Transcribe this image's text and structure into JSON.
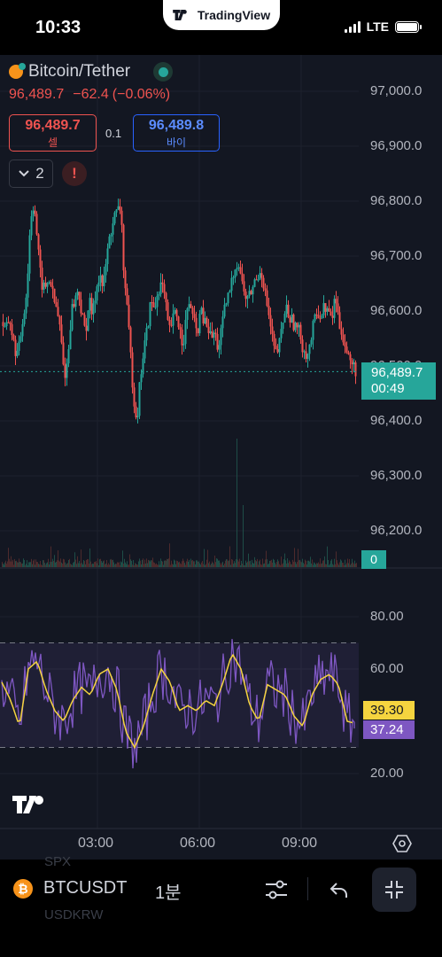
{
  "status_bar": {
    "time": "10:33",
    "network": "LTE",
    "app_brand": "TradingView"
  },
  "symbol": {
    "name": "Bitcoin/Tether",
    "last_price": "96,489.7",
    "change": "−62.4",
    "change_pct": "(−0.06%)"
  },
  "order": {
    "sell_price": "96,489.7",
    "sell_label": "셀",
    "spread": "0.1",
    "buy_price": "96,489.8",
    "buy_label": "바이"
  },
  "indicators_collapse": {
    "count": "2"
  },
  "price_axis": [
    "97,000.0",
    "96,900.0",
    "96,800.0",
    "96,700.0",
    "96,600.0",
    "96,500.0",
    "96,400.0",
    "96,300.0",
    "96,200.0"
  ],
  "price_tag": {
    "price": "96,489.7",
    "countdown": "00:49"
  },
  "volume_tag": "0",
  "rsi_axis": [
    "80.00",
    "60.00",
    "20.00"
  ],
  "rsi_tags": {
    "ma": "39.30",
    "rsi": "37.24"
  },
  "time_axis": [
    "03:00",
    "06:00",
    "09:00"
  ],
  "toolbar": {
    "ticker": "BTCUSDT",
    "interval": "1분",
    "ghost_above": "SPX",
    "ghost_below": "USDKRW"
  },
  "colors": {
    "up": "#26a69a",
    "down": "#ef5350",
    "rsi": "#7e57c2",
    "rsi_ma": "#f5d43f",
    "background": "#131722"
  },
  "chart_data": {
    "type": "candlestick",
    "price_ylim": [
      96150,
      97050
    ],
    "rsi_ylim": [
      20,
      80
    ],
    "rsi_band": [
      30,
      70
    ],
    "x_ticks": [
      "03:00",
      "06:00",
      "09:00"
    ],
    "close_path": [
      [
        0,
        96580
      ],
      [
        4,
        96560
      ],
      [
        8,
        96590
      ],
      [
        14,
        96530
      ],
      [
        18,
        96520
      ],
      [
        22,
        96570
      ],
      [
        28,
        96640
      ],
      [
        32,
        96770
      ],
      [
        36,
        96800
      ],
      [
        40,
        96720
      ],
      [
        44,
        96650
      ],
      [
        48,
        96640
      ],
      [
        54,
        96660
      ],
      [
        58,
        96620
      ],
      [
        62,
        96600
      ],
      [
        66,
        96560
      ],
      [
        70,
        96480
      ],
      [
        74,
        96510
      ],
      [
        78,
        96600
      ],
      [
        82,
        96620
      ],
      [
        86,
        96640
      ],
      [
        90,
        96590
      ],
      [
        94,
        96560
      ],
      [
        98,
        96620
      ],
      [
        102,
        96590
      ],
      [
        106,
        96640
      ],
      [
        110,
        96670
      ],
      [
        114,
        96640
      ],
      [
        118,
        96700
      ],
      [
        122,
        96740
      ],
      [
        126,
        96770
      ],
      [
        130,
        96780
      ],
      [
        134,
        96790
      ],
      [
        137,
        96680
      ],
      [
        140,
        96620
      ],
      [
        144,
        96540
      ],
      [
        148,
        96450
      ],
      [
        152,
        96400
      ],
      [
        156,
        96480
      ],
      [
        160,
        96530
      ],
      [
        164,
        96570
      ],
      [
        168,
        96620
      ],
      [
        172,
        96600
      ],
      [
        176,
        96640
      ],
      [
        180,
        96650
      ],
      [
        184,
        96620
      ],
      [
        188,
        96560
      ],
      [
        192,
        96580
      ],
      [
        196,
        96600
      ],
      [
        200,
        96570
      ],
      [
        204,
        96540
      ],
      [
        208,
        96590
      ],
      [
        212,
        96620
      ],
      [
        216,
        96580
      ],
      [
        220,
        96560
      ],
      [
        224,
        96600
      ],
      [
        228,
        96580
      ],
      [
        232,
        96570
      ],
      [
        236,
        96550
      ],
      [
        240,
        96560
      ],
      [
        244,
        96530
      ],
      [
        248,
        96570
      ],
      [
        252,
        96610
      ],
      [
        256,
        96630
      ],
      [
        260,
        96660
      ],
      [
        264,
        96690
      ],
      [
        268,
        96680
      ],
      [
        272,
        96640
      ],
      [
        276,
        96620
      ],
      [
        280,
        96630
      ],
      [
        284,
        96650
      ],
      [
        288,
        96660
      ],
      [
        292,
        96680
      ],
      [
        296,
        96640
      ],
      [
        300,
        96600
      ],
      [
        304,
        96560
      ],
      [
        308,
        96520
      ],
      [
        312,
        96530
      ],
      [
        316,
        96570
      ],
      [
        320,
        96610
      ],
      [
        324,
        96590
      ],
      [
        328,
        96580
      ],
      [
        332,
        96570
      ],
      [
        336,
        96560
      ],
      [
        340,
        96530
      ],
      [
        344,
        96520
      ],
      [
        348,
        96540
      ],
      [
        352,
        96580
      ],
      [
        356,
        96600
      ],
      [
        360,
        96590
      ],
      [
        364,
        96610
      ],
      [
        368,
        96600
      ],
      [
        372,
        96580
      ],
      [
        376,
        96630
      ],
      [
        380,
        96580
      ],
      [
        384,
        96560
      ],
      [
        388,
        96530
      ],
      [
        392,
        96510
      ],
      [
        396,
        96500
      ],
      [
        400,
        96489.7
      ]
    ],
    "rsi_path": [
      [
        0,
        55
      ],
      [
        10,
        48
      ],
      [
        20,
        38
      ],
      [
        30,
        60
      ],
      [
        40,
        63
      ],
      [
        50,
        52
      ],
      [
        60,
        44
      ],
      [
        70,
        40
      ],
      [
        80,
        48
      ],
      [
        90,
        53
      ],
      [
        100,
        50
      ],
      [
        110,
        58
      ],
      [
        120,
        60
      ],
      [
        130,
        52
      ],
      [
        140,
        36
      ],
      [
        150,
        30
      ],
      [
        160,
        38
      ],
      [
        170,
        50
      ],
      [
        180,
        60
      ],
      [
        190,
        55
      ],
      [
        200,
        44
      ],
      [
        210,
        46
      ],
      [
        220,
        44
      ],
      [
        230,
        48
      ],
      [
        240,
        46
      ],
      [
        250,
        55
      ],
      [
        260,
        66
      ],
      [
        270,
        60
      ],
      [
        280,
        46
      ],
      [
        290,
        40
      ],
      [
        300,
        54
      ],
      [
        310,
        52
      ],
      [
        320,
        50
      ],
      [
        330,
        42
      ],
      [
        340,
        38
      ],
      [
        350,
        50
      ],
      [
        360,
        56
      ],
      [
        370,
        58
      ],
      [
        380,
        54
      ],
      [
        390,
        40
      ],
      [
        398,
        39.3
      ]
    ]
  }
}
